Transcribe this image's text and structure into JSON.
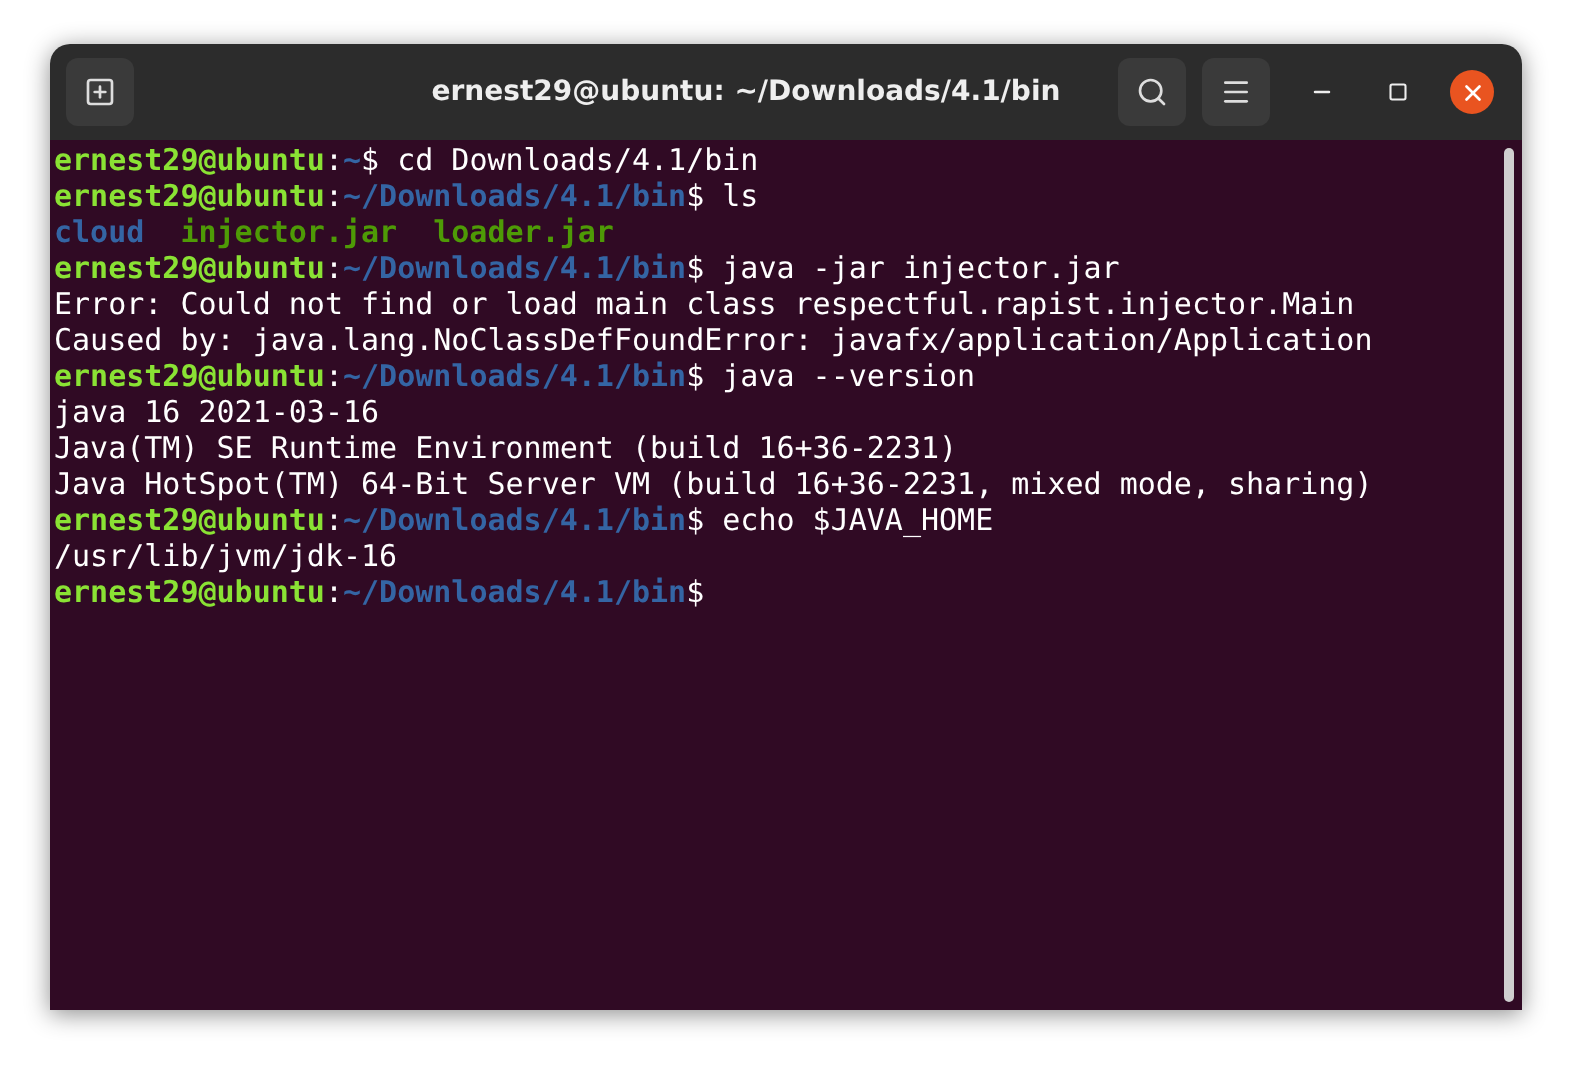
{
  "window": {
    "title": "ernest29@ubuntu: ~/Downloads/4.1/bin"
  },
  "terminal": {
    "lines": [
      {
        "kind": "prompt",
        "user": "ernest29@ubuntu",
        "colon": ":",
        "path": "~",
        "symbol": "$",
        "command": "cd Downloads/4.1/bin"
      },
      {
        "kind": "prompt",
        "user": "ernest29@ubuntu",
        "colon": ":",
        "path": "~/Downloads/4.1/bin",
        "symbol": "$",
        "command": "ls"
      },
      {
        "kind": "listing",
        "items": [
          {
            "kind": "directory",
            "name": "cloud"
          },
          {
            "kind": "executable",
            "name": "injector.jar"
          },
          {
            "kind": "executable",
            "name": "loader.jar"
          }
        ]
      },
      {
        "kind": "prompt",
        "user": "ernest29@ubuntu",
        "colon": ":",
        "path": "~/Downloads/4.1/bin",
        "symbol": "$",
        "command": "java -jar injector.jar"
      },
      {
        "kind": "output",
        "text": "Error: Could not find or load main class respectful.rapist.injector.Main"
      },
      {
        "kind": "output",
        "text": "Caused by: java.lang.NoClassDefFoundError: javafx/application/Application"
      },
      {
        "kind": "prompt",
        "user": "ernest29@ubuntu",
        "colon": ":",
        "path": "~/Downloads/4.1/bin",
        "symbol": "$",
        "command": "java --version"
      },
      {
        "kind": "output",
        "text": "java 16 2021-03-16"
      },
      {
        "kind": "output",
        "text": "Java(TM) SE Runtime Environment (build 16+36-2231)"
      },
      {
        "kind": "output",
        "text": "Java HotSpot(TM) 64-Bit Server VM (build 16+36-2231, mixed mode, sharing)"
      },
      {
        "kind": "prompt",
        "user": "ernest29@ubuntu",
        "colon": ":",
        "path": "~/Downloads/4.1/bin",
        "symbol": "$",
        "command": "echo $JAVA_HOME"
      },
      {
        "kind": "output",
        "text": "/usr/lib/jvm/jdk-16"
      },
      {
        "kind": "prompt",
        "user": "ernest29@ubuntu",
        "colon": ":",
        "path": "~/Downloads/4.1/bin",
        "symbol": "$"
      }
    ]
  }
}
